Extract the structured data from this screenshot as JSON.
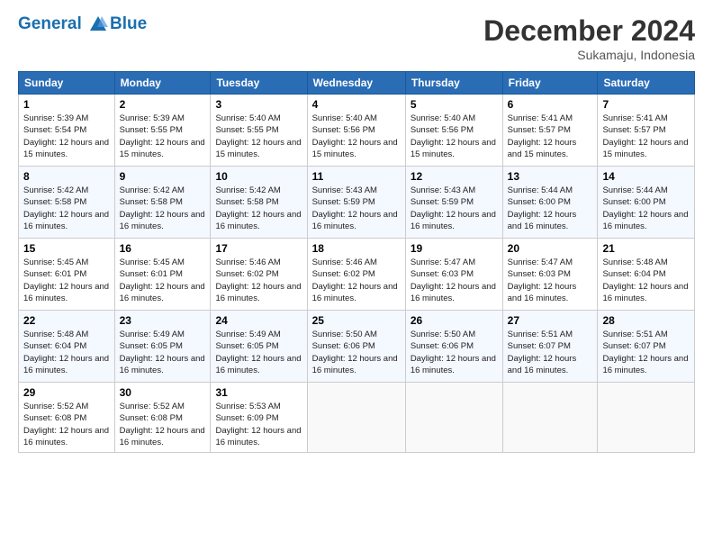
{
  "logo": {
    "line1": "General",
    "line2": "Blue"
  },
  "title": "December 2024",
  "subtitle": "Sukamaju, Indonesia",
  "days_of_week": [
    "Sunday",
    "Monday",
    "Tuesday",
    "Wednesday",
    "Thursday",
    "Friday",
    "Saturday"
  ],
  "weeks": [
    [
      {
        "day": "1",
        "sunrise": "5:39 AM",
        "sunset": "5:54 PM",
        "daylight": "12 hours and 15 minutes."
      },
      {
        "day": "2",
        "sunrise": "5:39 AM",
        "sunset": "5:55 PM",
        "daylight": "12 hours and 15 minutes."
      },
      {
        "day": "3",
        "sunrise": "5:40 AM",
        "sunset": "5:55 PM",
        "daylight": "12 hours and 15 minutes."
      },
      {
        "day": "4",
        "sunrise": "5:40 AM",
        "sunset": "5:56 PM",
        "daylight": "12 hours and 15 minutes."
      },
      {
        "day": "5",
        "sunrise": "5:40 AM",
        "sunset": "5:56 PM",
        "daylight": "12 hours and 15 minutes."
      },
      {
        "day": "6",
        "sunrise": "5:41 AM",
        "sunset": "5:57 PM",
        "daylight": "12 hours and 15 minutes."
      },
      {
        "day": "7",
        "sunrise": "5:41 AM",
        "sunset": "5:57 PM",
        "daylight": "12 hours and 15 minutes."
      }
    ],
    [
      {
        "day": "8",
        "sunrise": "5:42 AM",
        "sunset": "5:58 PM",
        "daylight": "12 hours and 16 minutes."
      },
      {
        "day": "9",
        "sunrise": "5:42 AM",
        "sunset": "5:58 PM",
        "daylight": "12 hours and 16 minutes."
      },
      {
        "day": "10",
        "sunrise": "5:42 AM",
        "sunset": "5:58 PM",
        "daylight": "12 hours and 16 minutes."
      },
      {
        "day": "11",
        "sunrise": "5:43 AM",
        "sunset": "5:59 PM",
        "daylight": "12 hours and 16 minutes."
      },
      {
        "day": "12",
        "sunrise": "5:43 AM",
        "sunset": "5:59 PM",
        "daylight": "12 hours and 16 minutes."
      },
      {
        "day": "13",
        "sunrise": "5:44 AM",
        "sunset": "6:00 PM",
        "daylight": "12 hours and 16 minutes."
      },
      {
        "day": "14",
        "sunrise": "5:44 AM",
        "sunset": "6:00 PM",
        "daylight": "12 hours and 16 minutes."
      }
    ],
    [
      {
        "day": "15",
        "sunrise": "5:45 AM",
        "sunset": "6:01 PM",
        "daylight": "12 hours and 16 minutes."
      },
      {
        "day": "16",
        "sunrise": "5:45 AM",
        "sunset": "6:01 PM",
        "daylight": "12 hours and 16 minutes."
      },
      {
        "day": "17",
        "sunrise": "5:46 AM",
        "sunset": "6:02 PM",
        "daylight": "12 hours and 16 minutes."
      },
      {
        "day": "18",
        "sunrise": "5:46 AM",
        "sunset": "6:02 PM",
        "daylight": "12 hours and 16 minutes."
      },
      {
        "day": "19",
        "sunrise": "5:47 AM",
        "sunset": "6:03 PM",
        "daylight": "12 hours and 16 minutes."
      },
      {
        "day": "20",
        "sunrise": "5:47 AM",
        "sunset": "6:03 PM",
        "daylight": "12 hours and 16 minutes."
      },
      {
        "day": "21",
        "sunrise": "5:48 AM",
        "sunset": "6:04 PM",
        "daylight": "12 hours and 16 minutes."
      }
    ],
    [
      {
        "day": "22",
        "sunrise": "5:48 AM",
        "sunset": "6:04 PM",
        "daylight": "12 hours and 16 minutes."
      },
      {
        "day": "23",
        "sunrise": "5:49 AM",
        "sunset": "6:05 PM",
        "daylight": "12 hours and 16 minutes."
      },
      {
        "day": "24",
        "sunrise": "5:49 AM",
        "sunset": "6:05 PM",
        "daylight": "12 hours and 16 minutes."
      },
      {
        "day": "25",
        "sunrise": "5:50 AM",
        "sunset": "6:06 PM",
        "daylight": "12 hours and 16 minutes."
      },
      {
        "day": "26",
        "sunrise": "5:50 AM",
        "sunset": "6:06 PM",
        "daylight": "12 hours and 16 minutes."
      },
      {
        "day": "27",
        "sunrise": "5:51 AM",
        "sunset": "6:07 PM",
        "daylight": "12 hours and 16 minutes."
      },
      {
        "day": "28",
        "sunrise": "5:51 AM",
        "sunset": "6:07 PM",
        "daylight": "12 hours and 16 minutes."
      }
    ],
    [
      {
        "day": "29",
        "sunrise": "5:52 AM",
        "sunset": "6:08 PM",
        "daylight": "12 hours and 16 minutes."
      },
      {
        "day": "30",
        "sunrise": "5:52 AM",
        "sunset": "6:08 PM",
        "daylight": "12 hours and 16 minutes."
      },
      {
        "day": "31",
        "sunrise": "5:53 AM",
        "sunset": "6:09 PM",
        "daylight": "12 hours and 16 minutes."
      },
      null,
      null,
      null,
      null
    ]
  ]
}
